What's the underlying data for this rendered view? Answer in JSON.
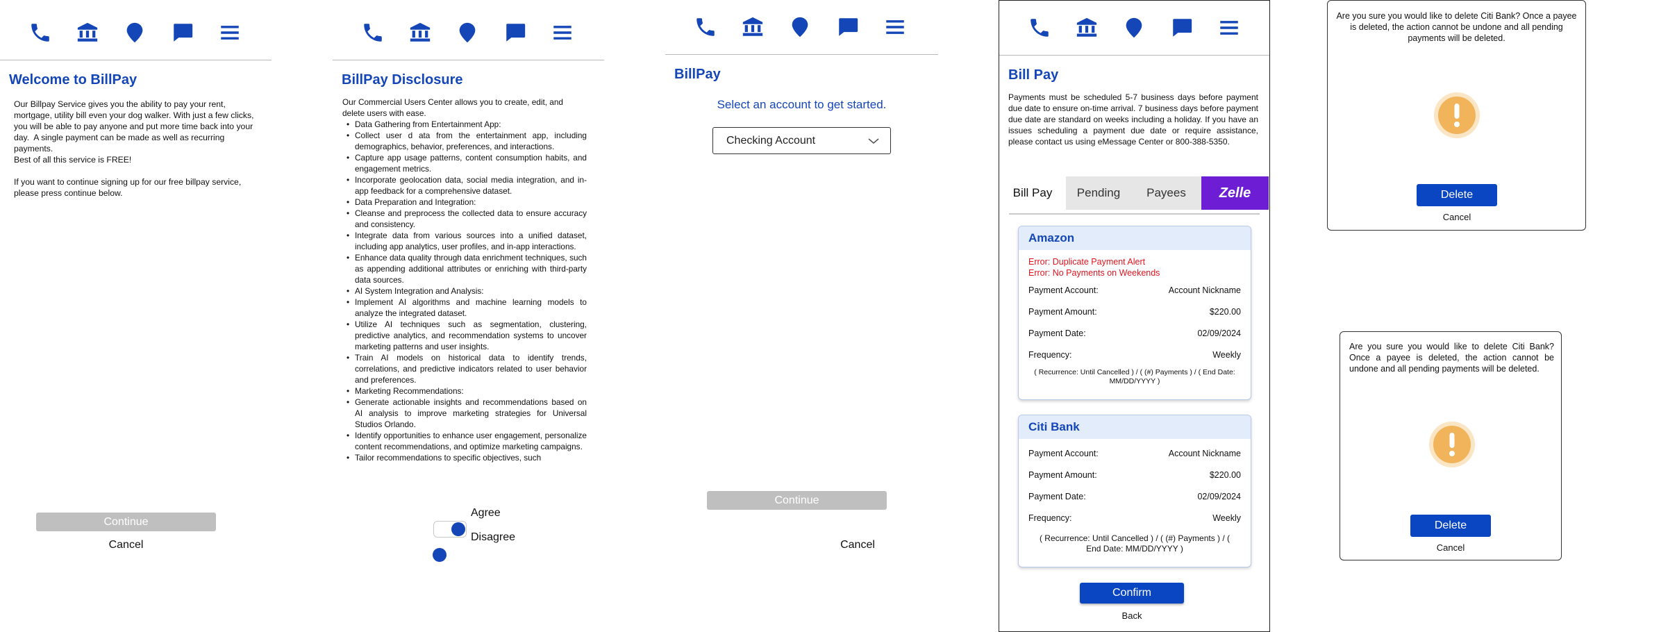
{
  "nav": {
    "icons": [
      "phone-icon",
      "bank-icon",
      "location-pin-icon",
      "chat-icon",
      "menu-icon"
    ],
    "color": "#1446b8"
  },
  "welcome": {
    "title": "Welcome to BillPay",
    "paragraph1": "Our Billpay Service gives you the ability to pay your rent, mortgage, utility bill even your dog walker. With just a few clicks, you will be able to pay anyone and put more time back into your day.  A single payment can be made as well as recurring payments.",
    "paragraph2": "Best of all this service is FREE!",
    "paragraph3": "If you want to continue signing up for our free billpay service, please press continue below.",
    "continue_label": "Continue",
    "cancel_label": "Cancel"
  },
  "disclosure": {
    "title": "BillPay Disclosure",
    "intro": "Our Commercial Users Center allows you to create, edit, and delete users with ease.",
    "items": [
      "Data Gathering from Entertainment App:",
      "Collect user d   ata from the entertainment app, including demographics, behavior, preferences, and interactions.",
      "Capture app usage patterns, content consumption habits, and engagement metrics.",
      "Incorporate geolocation data, social media integration, and in-app feedback for a comprehensive dataset.",
      "Data Preparation and Integration:",
      "Cleanse and preprocess the collected data to ensure accuracy and consistency.",
      "Integrate data from various sources into a unified dataset, including app analytics, user profiles, and in-app interactions.",
      "Enhance data quality through data enrichment techniques, such as appending additional attributes or enriching with third-party data sources.",
      "AI System Integration and Analysis:",
      "Implement AI algorithms and machine learning models to analyze the integrated dataset.",
      "Utilize AI techniques such as segmentation, clustering, predictive analytics, and recommendation systems to uncover marketing patterns and user insights.",
      "Train AI models on historical data to identify trends, correlations, and predictive indicators related to user behavior and preferences.",
      "Marketing Recommendations:",
      "Generate actionable insights and recommendations based on AI analysis to improve marketing strategies for Universal Studios Orlando.",
      "Identify opportunities to enhance user engagement, personalize content recommendations, and optimize marketing campaigns.",
      "Tailor recommendations to specific objectives, such"
    ],
    "agree_label": "Agree",
    "disagree_label": "Disagree"
  },
  "select_account": {
    "title": "BillPay",
    "prompt": "Select an account to get started.",
    "selected_account": "Checking Account",
    "continue_label": "Continue",
    "cancel_label": "Cancel"
  },
  "billpay": {
    "title": "Bill Pay",
    "notice": "Payments must be scheduled 5-7 business days before payment due date to ensure on-time arrival. 7 business days before payment due date are standard on weeks including a holiday. If you have an issues scheduling a payment due date or require assistance, please contact us using eMessage Center or 800-388-5350.",
    "tabs": [
      "Bill Pay",
      "Pending",
      "Payees",
      "Zelle"
    ],
    "payees": [
      {
        "name": "Amazon",
        "errors": [
          "Error: Duplicate Payment Alert",
          "Error: No Payments on Weekends"
        ],
        "account_label": "Payment Account:",
        "account_value": "Account Nickname",
        "amount_label": "Payment Amount:",
        "amount_value": "$220.00",
        "date_label": "Payment Date:",
        "date_value": "02/09/2024",
        "frequency_label": "Frequency:",
        "frequency_value": "Weekly",
        "recurrence": "( Recurrence: Until Cancelled )  / ( (#) Payments ) / ( End Date: MM/DD/YYYY )"
      },
      {
        "name": "Citi Bank",
        "errors": [],
        "account_label": "Payment Account:",
        "account_value": "Account Nickname",
        "amount_label": "Payment Amount:",
        "amount_value": "$220.00",
        "date_label": "Payment Date:",
        "date_value": "02/09/2024",
        "frequency_label": "Frequency:",
        "frequency_value": "Weekly",
        "recurrence": "( Recurrence: Until Cancelled )  / ( (#) Payments ) / ( End Date: MM/DD/YYYY )"
      }
    ],
    "confirm_label": "Confirm",
    "back_label": "Back",
    "zelle_color": "#6d1ed4"
  },
  "delete_dialog_1": {
    "message": "Are you sure you would like to delete Citi Bank? Once a payee is deleted, the action cannot be undone and all pending payments will be deleted.",
    "delete_label": "Delete",
    "cancel_label": "Cancel"
  },
  "delete_dialog_2": {
    "message": "Are you sure you would like to delete Citi Bank? Once a payee is deleted, the action cannot be undone and all pending payments will be deleted.",
    "delete_label": "Delete",
    "cancel_label": "Cancel"
  },
  "colors": {
    "brand_blue": "#1446b8",
    "button_blue": "#0a46c2",
    "disabled_gray": "#bfbfbf",
    "error_red": "#e0141e",
    "warning_orange": "#f2b45a"
  }
}
